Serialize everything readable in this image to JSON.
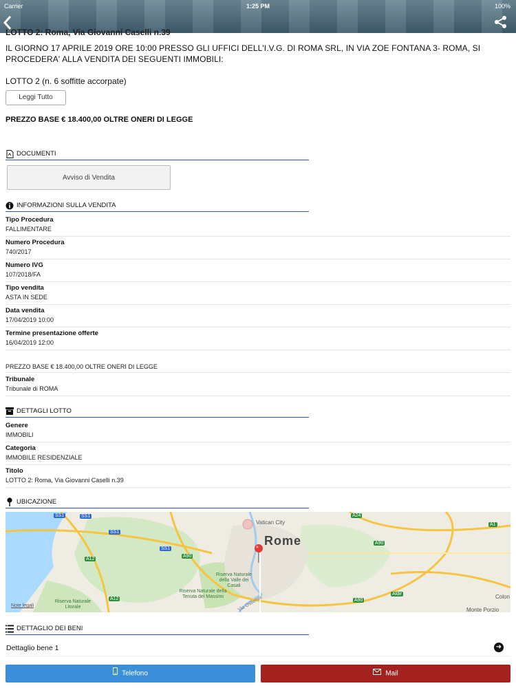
{
  "status_bar": {
    "carrier": "Carrier",
    "time": "1:25 PM",
    "battery": "100%"
  },
  "header": {
    "title": "LOTTO 2: Roma, Via Giovanni Caselli n.39"
  },
  "intro": {
    "text": "IL GIORNO 17 APRILE 2019 ORE 10:00 PRESSO GLI UFFICI DELL'I.V.G. DI ROMA SRL, IN VIA ZOE FONTANA 3- ROMA, SI PROCEDERA' ALLA VENDITA DEI SEGUENTI IMMOBILI:",
    "lotto": "LOTTO  2 (n. 6 soffitte accorpate)",
    "read_more": "Leggi Tutto",
    "price": "PREZZO BASE €  18.400,00 OLTRE ONERI DI LEGGE"
  },
  "documents": {
    "heading": "DOCUMENTI",
    "button": "Avviso di Vendita"
  },
  "sale_info": {
    "heading": "INFORMAZIONI SULLA VENDITA",
    "rows": [
      {
        "label": "Tipo Procedura",
        "value": "FALLIMENTARE"
      },
      {
        "label": "Numero Procedura",
        "value": "740/2017"
      },
      {
        "label": "Numero IVG",
        "value": "107/2018/FA"
      },
      {
        "label": "Tipo vendita",
        "value": "ASTA IN SEDE"
      },
      {
        "label": "Data vendita",
        "value": "17/04/2019 10:00"
      },
      {
        "label": "Termine presentazione offerte",
        "value": "16/04/2019 12:00"
      }
    ],
    "price_note": "PREZZO BASE €  18.400,00 OLTRE ONERI DI LEGGE",
    "court_label": "Tribunale",
    "court_value": "Tribunale di ROMA"
  },
  "lot_details": {
    "heading": "DETTAGLI LOTTO",
    "rows": [
      {
        "label": "Genere",
        "value": "IMMOBILI"
      },
      {
        "label": "Categoria",
        "value": "IMMOBILE RESIDENZIALE"
      },
      {
        "label": "Titolo",
        "value": "LOTTO 2: Roma, Via Giovanni Caselli n.39"
      }
    ]
  },
  "location": {
    "heading": "UBICAZIONE",
    "map": {
      "city": "Rome",
      "vatican": "Vatican City",
      "legal": "Note legali",
      "park1": "Riserva Naturale della Valle dei Casali",
      "park2": "Riserva Naturale della Tenuta dei Massimi",
      "park3": "Riserva Naturale Litorale",
      "roads": [
        "SS1",
        "SS1",
        "SS1",
        "SS1",
        "A12",
        "A12",
        "A90",
        "A90",
        "A90",
        "A24",
        "A1",
        "Aldir"
      ],
      "place_right": "Colon",
      "place_bottom": "Monte Porzio",
      "street": "Via Ostiense"
    }
  },
  "goods": {
    "heading": "DETTAGLIO DEI BENI",
    "item": "Dettaglio bene 1"
  },
  "actions": {
    "phone": "Telefono",
    "mail": "Mail"
  },
  "colors": {
    "accent_line": "#2d5aa3",
    "phone_btn": "#3a8fd8",
    "mail_btn": "#a32220"
  }
}
